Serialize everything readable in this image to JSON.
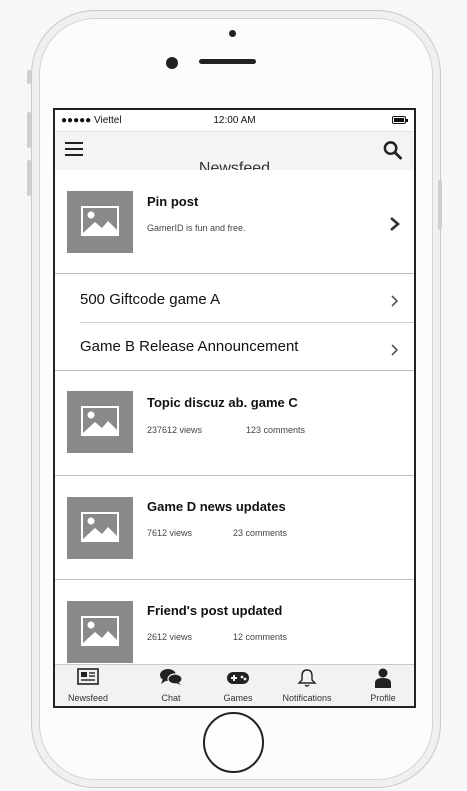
{
  "status_bar": {
    "carrier": "●●●●● Viettel",
    "time": "12:00 AM"
  },
  "nav": {
    "title": "Newsfeed",
    "menu_icon": "hamburger-icon",
    "search_icon": "search-icon"
  },
  "pinned": {
    "title": "Pin post",
    "subtitle": "GamerID is fun and free."
  },
  "links": [
    {
      "label": "500 Giftcode game A"
    },
    {
      "label": "Game B Release Announcement"
    }
  ],
  "posts": [
    {
      "title": "Topic discuz ab. game C",
      "views": "237612 views",
      "comments": "123 comments"
    },
    {
      "title": "Game D news updates",
      "views": "7612 views",
      "comments": "23 comments"
    },
    {
      "title": "Friend's post updated",
      "views": "2612 views",
      "comments": "12 comments"
    }
  ],
  "tabs": [
    {
      "label": "Newsfeed",
      "icon": "newspaper-icon"
    },
    {
      "label": "Chat",
      "icon": "chat-bubbles-icon"
    },
    {
      "label": "Games",
      "icon": "gamepad-icon"
    },
    {
      "label": "Notifications",
      "icon": "bell-icon"
    },
    {
      "label": "Profile",
      "icon": "user-icon"
    }
  ]
}
